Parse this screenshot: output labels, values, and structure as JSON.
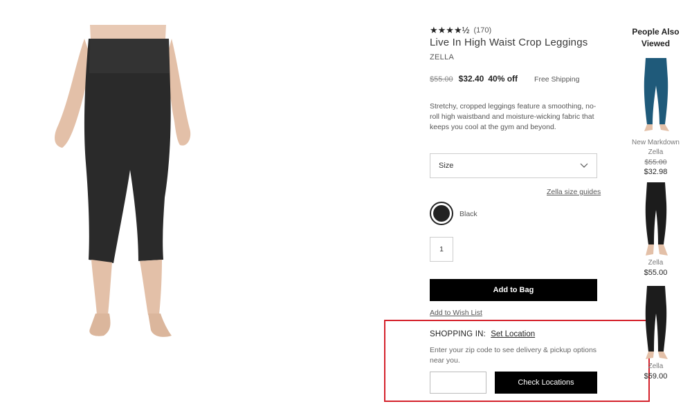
{
  "product": {
    "rating_stars": "★★★★½",
    "review_count": "(170)",
    "title": "Live In High Waist Crop Leggings",
    "brand": "ZELLA",
    "original_price": "$55.00",
    "sale_price": "$32.40",
    "discount": "40% off",
    "shipping": "Free Shipping",
    "description": "Stretchy, cropped leggings feature a smoothing, no-roll high waistband and moisture-wicking fabric that keeps you cool at the gym and beyond."
  },
  "options": {
    "size_label": "Size",
    "size_guide": "Zella size guides",
    "color_name": "Black",
    "color_hex": "#222222",
    "quantity": "1"
  },
  "actions": {
    "add_to_bag": "Add to Bag",
    "add_to_wishlist": "Add to Wish List"
  },
  "shopping_in": {
    "label": "SHOPPING IN:",
    "set_location": "Set Location",
    "help": "Enter your zip code to see delivery & pickup options near you.",
    "zip_placeholder": "",
    "check_button": "Check Locations"
  },
  "people_also_viewed": {
    "title": "People Also Viewed",
    "items": [
      {
        "badge": "New Markdown",
        "brand": "Zella",
        "original_price": "$55.00",
        "price": "$32.98",
        "color": "#1f5a7a"
      },
      {
        "badge": "",
        "brand": "Zella",
        "original_price": "",
        "price": "$55.00",
        "color": "#1c1c1c"
      },
      {
        "badge": "",
        "brand": "Zella",
        "original_price": "",
        "price": "$59.00",
        "color": "#1c1c1c"
      }
    ]
  },
  "colors": {
    "highlight": "#d4202a",
    "button_bg": "#000000"
  }
}
